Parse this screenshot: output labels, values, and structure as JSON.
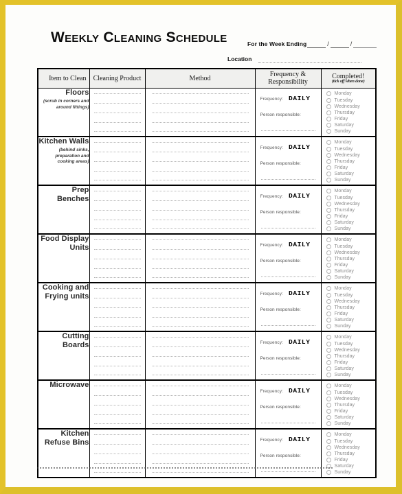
{
  "document": {
    "title": "Weekly Cleaning Schedule",
    "week_ending_label": "For the Week Ending",
    "date_separator": "/",
    "location_label": "Location"
  },
  "table": {
    "headers": {
      "item": "Item to Clean",
      "product": "Cleaning Product",
      "method": "Method",
      "frequency": "Frequency & Responsibility",
      "completed": "Completed!",
      "completed_sub": "(tick off when done)"
    },
    "labels": {
      "frequency_label": "Frequency:",
      "person_label": "Person responsible:"
    },
    "days": [
      "Monday",
      "Tuesday",
      "Wednesday",
      "Thursday",
      "Friday",
      "Saturday",
      "Sunday"
    ],
    "rows": [
      {
        "name": "Floors",
        "note": "(scrub in corners and around fittings)",
        "frequency": "DAILY",
        "product": "",
        "method": "",
        "person": ""
      },
      {
        "name": "Kitchen Walls",
        "note": "(behind sinks, preparation and cooking areas)",
        "frequency": "DAILY",
        "product": "",
        "method": "",
        "person": ""
      },
      {
        "name": "Prep Benches",
        "note": "",
        "frequency": "DAILY",
        "product": "",
        "method": "",
        "person": ""
      },
      {
        "name": "Food Display Units",
        "note": "",
        "frequency": "DAILY",
        "product": "",
        "method": "",
        "person": ""
      },
      {
        "name": "Cooking and Frying units",
        "note": "",
        "frequency": "DAILY",
        "product": "",
        "method": "",
        "person": ""
      },
      {
        "name": "Cutting Boards",
        "note": "",
        "frequency": "DAILY",
        "product": "",
        "method": "",
        "person": ""
      },
      {
        "name": "Microwave",
        "note": "",
        "frequency": "DAILY",
        "product": "",
        "method": "",
        "person": ""
      },
      {
        "name": "Kitchen Refuse Bins",
        "note": "",
        "frequency": "DAILY",
        "product": "",
        "method": "",
        "person": ""
      }
    ]
  },
  "colors": {
    "page_border": "#e3c229",
    "table_border": "#000000",
    "header_fill": "#f0f0ee",
    "day_text": "#8d8d8d"
  }
}
